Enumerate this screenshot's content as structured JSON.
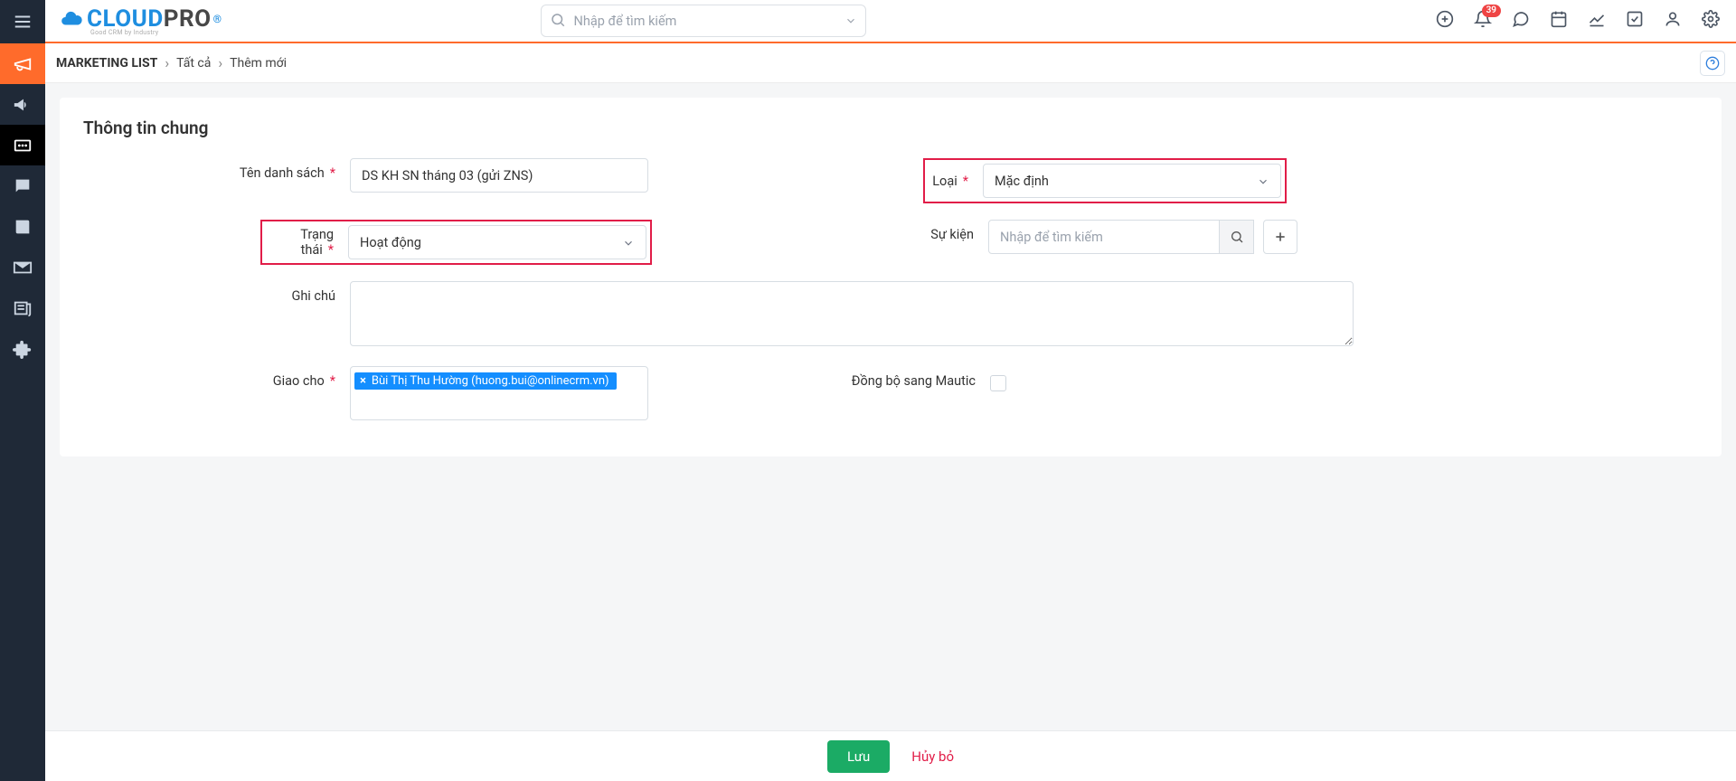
{
  "logo": {
    "part1": "CLOUD",
    "part2": "PRO",
    "sub": "Good CRM by Industry"
  },
  "search": {
    "placeholder": "Nhập để tìm kiếm"
  },
  "notifications": {
    "count": "39"
  },
  "breadcrumb": {
    "root": "MARKETING LIST",
    "level1": "Tất cả",
    "level2": "Thêm mới"
  },
  "section_title": "Thông tin chung",
  "labels": {
    "name": "Tên danh sách",
    "type": "Loại",
    "status": "Trạng thái",
    "event": "Sự kiện",
    "note": "Ghi chú",
    "assigned": "Giao cho",
    "sync": "Đồng bộ sang Mautic"
  },
  "values": {
    "name": "DS KH SN tháng 03 (gửi ZNS)",
    "type": "Mặc định",
    "status": "Hoạt động",
    "event_placeholder": "Nhập để tìm kiếm",
    "assigned_tag": "Bùi Thị Thu Hường (huong.bui@onlinecrm.vn)"
  },
  "footer": {
    "save": "Lưu",
    "cancel": "Hủy bỏ"
  }
}
